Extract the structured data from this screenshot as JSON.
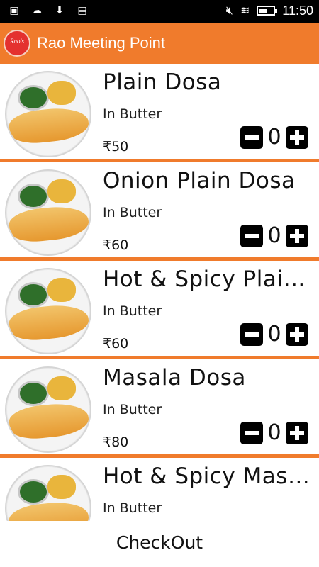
{
  "status_bar": {
    "time": "11:50",
    "left_icons": [
      "image-icon",
      "cloud-icon",
      "download-icon",
      "briefcase-icon"
    ],
    "right_icons": [
      "mute-icon",
      "wifi-icon",
      "battery-icon"
    ],
    "battery_level": 0.55
  },
  "app_bar": {
    "logo_text": "Rao's",
    "title": "Rao Meeting Point",
    "background": "#f07b2c"
  },
  "items": [
    {
      "name": "Plain Dosa",
      "desc": "In Butter",
      "price": "₹50",
      "qty": "0"
    },
    {
      "name": "Onion Plain Dosa",
      "desc": "In Butter",
      "price": "₹60",
      "qty": "0"
    },
    {
      "name": "Hot & Spicy Plain D...",
      "desc": "In Butter",
      "price": "₹60",
      "qty": "0"
    },
    {
      "name": "Masala Dosa",
      "desc": "In Butter",
      "price": "₹80",
      "qty": "0"
    },
    {
      "name": "Hot & Spicy Masala...",
      "desc": "In Butter",
      "price": "",
      "qty": ""
    }
  ],
  "checkout": {
    "label": "CheckOut"
  },
  "colors": {
    "accent": "#f07b2c",
    "button": "#000000"
  }
}
